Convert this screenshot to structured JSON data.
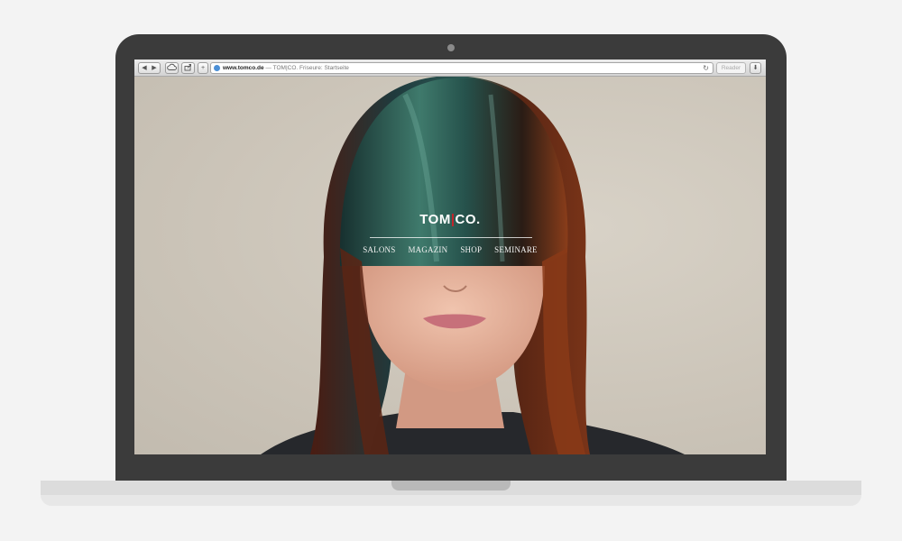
{
  "browser": {
    "back_icon": "back-arrow-icon",
    "forward_icon": "forward-arrow-icon",
    "address": {
      "url": "www.tomco.de",
      "separator": " — ",
      "page_title": "TOM|CO. Friseure: Startseite"
    },
    "reader_label": "Reader"
  },
  "site": {
    "logo_left": "TOM",
    "logo_slash": "|",
    "logo_right": "CO.",
    "nav": [
      "SALONS",
      "MAGAZIN",
      "SHOP",
      "SEMINARE"
    ],
    "accent_color": "#c8242b"
  }
}
